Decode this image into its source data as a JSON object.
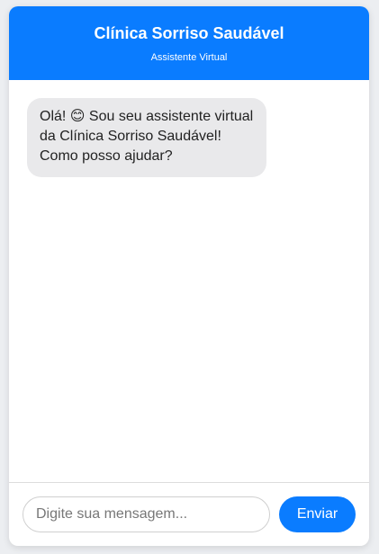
{
  "header": {
    "title": "Clínica Sorriso Saudável",
    "subtitle": "Assistente Virtual"
  },
  "messages": [
    {
      "sender": "bot",
      "text": "Olá! 😊 Sou seu assistente virtual da Clínica Sorriso Saudável! Como posso ajudar?"
    }
  ],
  "input": {
    "placeholder": "Digite sua mensagem...",
    "value": ""
  },
  "send_label": "Enviar",
  "colors": {
    "accent": "#0a7cff",
    "bot_bubble": "#e9e9eb"
  }
}
